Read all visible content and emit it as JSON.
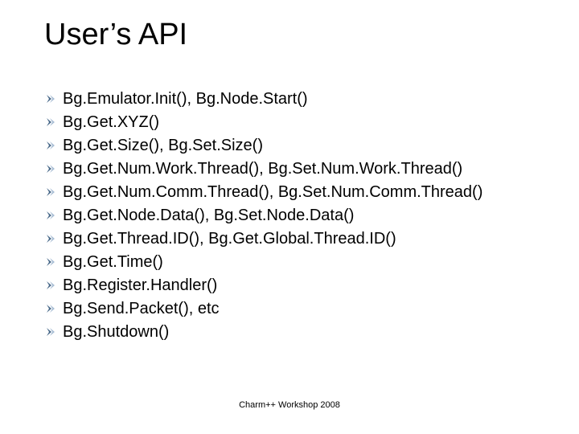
{
  "title": "User’s API",
  "items": [
    "Bg.Emulator.Init(), Bg.Node.Start()",
    "Bg.Get.XYZ()",
    "Bg.Get.Size(), Bg.Set.Size()",
    "Bg.Get.Num.Work.Thread(), Bg.Set.Num.Work.Thread()",
    "Bg.Get.Num.Comm.Thread(), Bg.Set.Num.Comm.Thread()",
    "Bg.Get.Node.Data(), Bg.Set.Node.Data()",
    "Bg.Get.Thread.ID(),  Bg.Get.Global.Thread.ID()",
    "Bg.Get.Time()",
    "Bg.Register.Handler()",
    "Bg.Send.Packet(), etc",
    "Bg.Shutdown()"
  ],
  "footer": "Charm++ Workshop 2008"
}
